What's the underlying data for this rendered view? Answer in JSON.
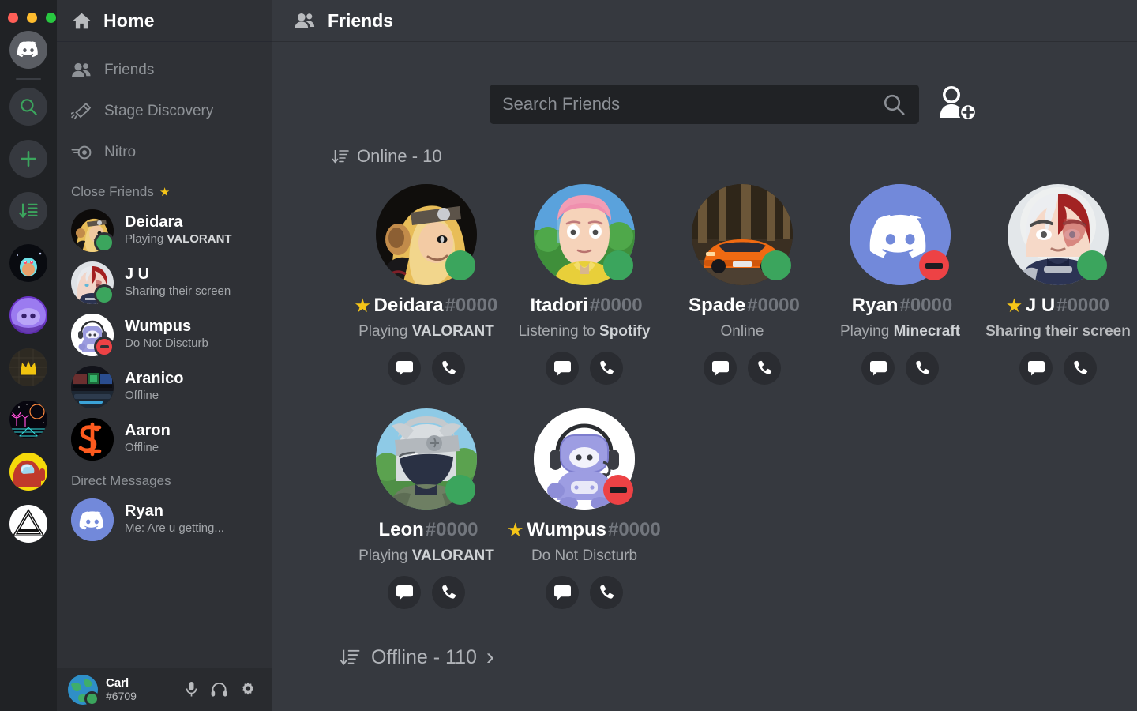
{
  "window": {
    "traffic_lights": [
      "close",
      "minimize",
      "zoom"
    ]
  },
  "rail": {
    "items": [
      {
        "name": "discord-home",
        "icon": "discord-logo",
        "label": "Home"
      },
      {
        "name": "explore-servers",
        "icon": "search-icon",
        "label": "Explore Public Servers"
      },
      {
        "name": "add-server",
        "icon": "plus-icon",
        "label": "Add a Server"
      },
      {
        "name": "download-apps",
        "icon": "download-list-icon",
        "label": "Download Apps"
      },
      {
        "name": "server-squirtle",
        "icon": "server-avatar",
        "label": "Server"
      },
      {
        "name": "server-purple-discord",
        "icon": "server-avatar",
        "label": "Server"
      },
      {
        "name": "server-crown",
        "icon": "server-avatar",
        "label": "Server"
      },
      {
        "name": "server-synthwave",
        "icon": "server-avatar",
        "label": "Server"
      },
      {
        "name": "server-amongus",
        "icon": "server-avatar",
        "label": "Server"
      },
      {
        "name": "server-palace",
        "icon": "server-avatar",
        "label": "Server"
      }
    ]
  },
  "sidebar": {
    "header": {
      "title": "Home",
      "icon": "home-icon"
    },
    "nav": [
      {
        "label": "Friends",
        "icon": "friends-icon"
      },
      {
        "label": "Stage Discovery",
        "icon": "stage-icon"
      },
      {
        "label": "Nitro",
        "icon": "nitro-icon"
      }
    ],
    "close_friends_label": "Close Friends",
    "close_friends_star": "★",
    "close_friends": [
      {
        "name": "Deidara",
        "status_prefix": "Playing ",
        "status_strong": "VALORANT",
        "presence": "online"
      },
      {
        "name": "J U",
        "status_prefix": "Sharing their screen",
        "status_strong": "",
        "presence": "online"
      },
      {
        "name": "Wumpus",
        "status_prefix": "Do Not Discturb",
        "status_strong": "",
        "presence": "dnd"
      },
      {
        "name": "Aranico",
        "status_prefix": "Offline",
        "status_strong": "",
        "presence": "offline"
      },
      {
        "name": "Aaron",
        "status_prefix": "Offline",
        "status_strong": "",
        "presence": "offline"
      }
    ],
    "dm_label": "Direct Messages",
    "dms": [
      {
        "name": "Ryan",
        "status_prefix": "Me: Are u getting...",
        "status_strong": "",
        "presence": "none"
      }
    ]
  },
  "userbar": {
    "name": "Carl",
    "tag": "#6709",
    "presence": "online",
    "icons": [
      {
        "name": "microphone-icon"
      },
      {
        "name": "headphones-icon"
      },
      {
        "name": "gear-icon"
      }
    ]
  },
  "main": {
    "header": {
      "title": "Friends",
      "icon": "friends-icon"
    },
    "search": {
      "placeholder": "Search Friends",
      "value": "",
      "icon": "search-icon"
    },
    "add_friend_icon": "add-friend-icon",
    "online_section": {
      "label": "Online - 10",
      "icon": "sort-icon"
    },
    "offline_section": {
      "label": "Offline - 110",
      "icon": "sort-icon",
      "chevron": "›"
    },
    "friends": [
      {
        "name": "Deidara",
        "tag": "#0000",
        "favorite": true,
        "star": "★",
        "presence": "online",
        "avatar": "deidara",
        "status_prefix": "Playing ",
        "status_strong": "VALORANT",
        "status_bold": false
      },
      {
        "name": "Itadori",
        "tag": "#0000",
        "favorite": false,
        "star": "",
        "presence": "online",
        "avatar": "itadori",
        "status_prefix": "Listening to ",
        "status_strong": "Spotify",
        "status_bold": false
      },
      {
        "name": "Spade",
        "tag": "#0000",
        "favorite": false,
        "star": "",
        "presence": "online",
        "avatar": "lambo",
        "status_prefix": "Online",
        "status_strong": "",
        "status_bold": false
      },
      {
        "name": "Ryan",
        "tag": "#0000",
        "favorite": false,
        "star": "",
        "presence": "dnd",
        "avatar": "discord",
        "status_prefix": "Playing ",
        "status_strong": "Minecraft",
        "status_bold": false
      },
      {
        "name": "J U",
        "tag": "#0000",
        "favorite": true,
        "star": "★",
        "presence": "online",
        "avatar": "todoroki",
        "status_prefix": "Sharing their screen",
        "status_strong": "",
        "status_bold": true
      },
      {
        "name": "Leon",
        "tag": "#0000",
        "favorite": false,
        "star": "",
        "presence": "online",
        "avatar": "kakashi",
        "status_prefix": "Playing ",
        "status_strong": "VALORANT",
        "status_bold": false
      },
      {
        "name": "Wumpus",
        "tag": "#0000",
        "favorite": true,
        "star": "★",
        "presence": "dnd",
        "avatar": "wumpus",
        "status_prefix": "Do Not Discturb",
        "status_strong": "",
        "status_bold": false
      }
    ],
    "card_actions": [
      {
        "name": "message-button",
        "icon": "chat-bubble-icon"
      },
      {
        "name": "call-button",
        "icon": "phone-icon"
      }
    ]
  },
  "colors": {
    "rail_bg": "#202225",
    "sidebar_bg": "#2f3136",
    "main_bg": "#36393f",
    "online": "#3ba55d",
    "dnd": "#ed4245",
    "accent_star": "#f5c518",
    "blurple": "#7289da"
  }
}
